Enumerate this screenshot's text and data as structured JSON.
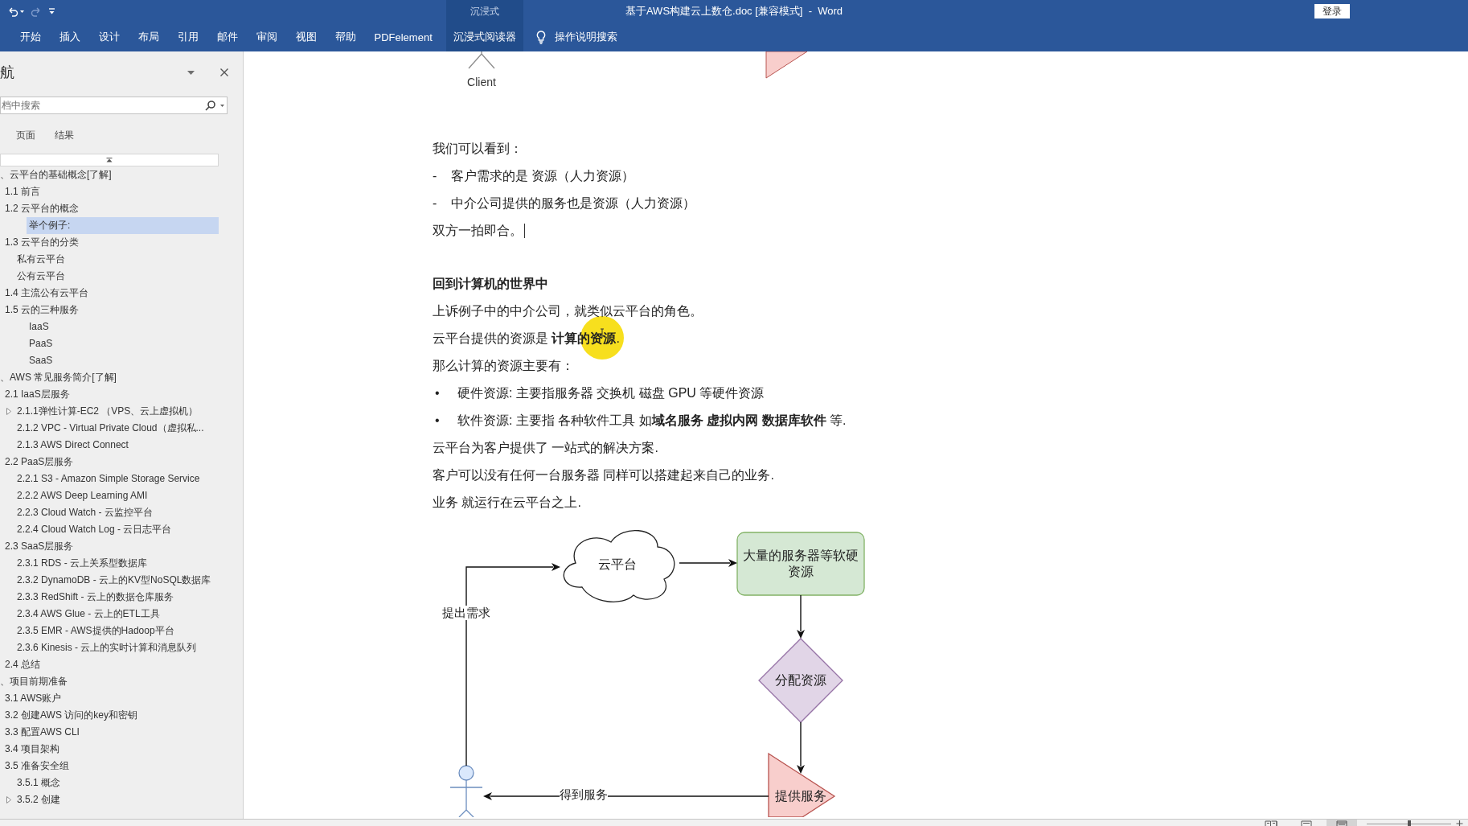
{
  "title_bar": {
    "quick_access": [
      {
        "kind": "undo",
        "disabled": false
      },
      {
        "kind": "redo",
        "disabled": true
      },
      {
        "kind": "customize",
        "disabled": false
      }
    ],
    "title": "基于AWS构建云上数仓.doc [兼容模式]  -  Word",
    "sign_in": "登录"
  },
  "ribbon": {
    "tabs": [
      {
        "label": "开始",
        "kind": "standard",
        "selected": false
      },
      {
        "label": "插入",
        "kind": "standard",
        "selected": false
      },
      {
        "label": "设计",
        "kind": "standard",
        "selected": false
      },
      {
        "label": "布局",
        "kind": "standard",
        "selected": false
      },
      {
        "label": "引用",
        "kind": "standard",
        "selected": false
      },
      {
        "label": "邮件",
        "kind": "standard",
        "selected": false
      },
      {
        "label": "审阅",
        "kind": "standard",
        "selected": false
      },
      {
        "label": "视图",
        "kind": "standard",
        "selected": false
      },
      {
        "label": "帮助",
        "kind": "standard",
        "selected": false
      },
      {
        "label": "PDFelement",
        "kind": "standard",
        "selected": false
      },
      {
        "label": "沉浸式阅读器",
        "kind": "contextual",
        "group": "沉浸式",
        "selected": false
      }
    ],
    "tell_me": "操作说明搜索"
  },
  "navigation_pane": {
    "title": "航",
    "search": {
      "placeholder": "档中搜索"
    },
    "tabs": [
      {
        "label": "页面",
        "selected": false
      },
      {
        "label": "结果",
        "selected": false
      }
    ],
    "tree": [
      {
        "label": "、云平台的基础概念[了解]",
        "kind": "normal",
        "selected": false,
        "collapsed": false,
        "children": [
          {
            "label": "1.1 前言",
            "kind": "normal",
            "selected": false,
            "collapsed": false
          },
          {
            "label": "1.2 云平台的概念",
            "kind": "normal",
            "selected": false,
            "collapsed": false,
            "children": [
              {
                "label": "举个例子:",
                "kind": "deep",
                "selected": true,
                "collapsed": false
              }
            ]
          },
          {
            "label": "1.3 云平台的分类",
            "kind": "normal",
            "selected": false,
            "collapsed": false,
            "children": [
              {
                "label": "私有云平台",
                "kind": "normal",
                "selected": false,
                "collapsed": false
              },
              {
                "label": "公有云平台",
                "kind": "normal",
                "selected": false,
                "collapsed": false
              }
            ]
          },
          {
            "label": "1.4 主流公有云平台",
            "kind": "normal",
            "selected": false,
            "collapsed": false
          },
          {
            "label": "1.5 云的三种服务",
            "kind": "normal",
            "selected": false,
            "collapsed": false,
            "children": [
              {
                "label": "IaaS",
                "kind": "deep",
                "selected": false,
                "collapsed": false
              },
              {
                "label": "PaaS",
                "kind": "deep",
                "selected": false,
                "collapsed": false
              },
              {
                "label": "SaaS",
                "kind": "deep",
                "selected": false,
                "collapsed": false
              }
            ]
          }
        ]
      },
      {
        "label": "、AWS 常见服务简介[了解]",
        "kind": "normal",
        "selected": false,
        "collapsed": false,
        "children": [
          {
            "label": "2.1 IaaS层服务",
            "kind": "normal",
            "selected": false,
            "collapsed": false,
            "children": [
              {
                "label": "2.1.1弹性计算-EC2 （VPS、云上虚拟机）",
                "kind": "normal",
                "selected": false,
                "collapsed": true
              },
              {
                "label": "2.1.2 VPC - Virtual Private Cloud（虚拟私...",
                "kind": "normal",
                "selected": false,
                "collapsed": false
              },
              {
                "label": "2.1.3 AWS Direct Connect",
                "kind": "normal",
                "selected": false,
                "collapsed": false
              }
            ]
          },
          {
            "label": "2.2 PaaS层服务",
            "kind": "normal",
            "selected": false,
            "collapsed": false,
            "children": [
              {
                "label": "2.2.1 S3 - Amazon Simple Storage Service",
                "kind": "normal",
                "selected": false,
                "collapsed": false
              },
              {
                "label": "2.2.2 AWS Deep Learning AMI",
                "kind": "normal",
                "selected": false,
                "collapsed": false
              },
              {
                "label": "2.2.3 Cloud Watch - 云监控平台",
                "kind": "normal",
                "selected": false,
                "collapsed": false
              },
              {
                "label": "2.2.4 Cloud Watch Log - 云日志平台",
                "kind": "normal",
                "selected": false,
                "collapsed": false
              }
            ]
          },
          {
            "label": "2.3 SaaS层服务",
            "kind": "normal",
            "selected": false,
            "collapsed": false,
            "children": [
              {
                "label": "2.3.1 RDS - 云上关系型数据库",
                "kind": "normal",
                "selected": false,
                "collapsed": false
              },
              {
                "label": "2.3.2 DynamoDB - 云上的KV型NoSQL数据库",
                "kind": "normal",
                "selected": false,
                "collapsed": false
              },
              {
                "label": "2.3.3 RedShift - 云上的数据仓库服务",
                "kind": "normal",
                "selected": false,
                "collapsed": false
              },
              {
                "label": "2.3.4 AWS Glue - 云上的ETL工具",
                "kind": "normal",
                "selected": false,
                "collapsed": false
              },
              {
                "label": "2.3.5 EMR - AWS提供的Hadoop平台",
                "kind": "normal",
                "selected": false,
                "collapsed": false
              },
              {
                "label": "2.3.6 Kinesis - 云上的实时计算和消息队列",
                "kind": "normal",
                "selected": false,
                "collapsed": false
              }
            ]
          },
          {
            "label": "2.4 总结",
            "kind": "normal",
            "selected": false,
            "collapsed": false
          }
        ]
      },
      {
        "label": "、项目前期准备",
        "kind": "normal",
        "selected": false,
        "collapsed": false,
        "children": [
          {
            "label": "3.1 AWS账户",
            "kind": "normal",
            "selected": false,
            "collapsed": false
          },
          {
            "label": "3.2 创建AWS 访问的key和密钥",
            "kind": "normal",
            "selected": false,
            "collapsed": false
          },
          {
            "label": "3.3 配置AWS CLI",
            "kind": "normal",
            "selected": false,
            "collapsed": false
          },
          {
            "label": "3.4 项目架构",
            "kind": "normal",
            "selected": false,
            "collapsed": false
          },
          {
            "label": "3.5 准备安全组",
            "kind": "normal",
            "selected": false,
            "collapsed": false,
            "children": [
              {
                "label": "3.5.1 概念",
                "kind": "normal",
                "selected": false,
                "collapsed": false
              },
              {
                "label": "3.5.2 创建",
                "kind": "normal",
                "selected": false,
                "collapsed": true
              }
            ]
          }
        ]
      }
    ]
  },
  "document": {
    "previous_figure": {
      "label": "Client"
    },
    "paragraphs": [
      {
        "kind": "text",
        "text": "我们可以看到：",
        "cursor": false,
        "pointer": false
      },
      {
        "kind": "dash",
        "marker": "-",
        "text": "客户需求的是 资源（人力资源）",
        "cursor": false,
        "pointer": false
      },
      {
        "kind": "dash",
        "marker": "-",
        "text": "中介公司提供的服务也是资源（人力资源）",
        "cursor": false,
        "pointer": false
      },
      {
        "kind": "text",
        "text": "双方一拍即合。",
        "cursor": true,
        "pointer": false
      },
      {
        "kind": "heading",
        "text": "回到计算机的世界中",
        "cursor": false,
        "pointer": false
      },
      {
        "kind": "text",
        "text": "上诉例子中的中介公司，就类似云平台的角色。",
        "cursor": false,
        "pointer": false
      },
      {
        "kind": "text",
        "text": "云平台提供的资源是 **计算的资源**.",
        "cursor": false,
        "pointer": true
      },
      {
        "kind": "text",
        "text": "那么计算的资源主要有：",
        "cursor": false,
        "pointer": false
      },
      {
        "kind": "bullet",
        "marker": "•",
        "text": "硬件资源: 主要指服务器 交换机 磁盘 GPU 等硬件资源",
        "cursor": false,
        "pointer": false
      },
      {
        "kind": "bullet",
        "marker": "•",
        "text": "软件资源: 主要指 各种软件工具 如**域名服务 虚拟内网 数据库软件** 等.",
        "cursor": false,
        "pointer": false
      },
      {
        "kind": "text",
        "text": "云平台为客户提供了 一站式的解决方案.",
        "cursor": false,
        "pointer": false
      },
      {
        "kind": "text",
        "text": "客户可以没有任何一台服务器 同样可以搭建起来自己的业务.",
        "cursor": false,
        "pointer": false
      },
      {
        "kind": "text",
        "text": "业务 就运行在云平台之上.",
        "cursor": false,
        "pointer": false
      }
    ],
    "diagram": {
      "nodes": [
        {
          "kind": "cloud",
          "label": "云平台"
        },
        {
          "kind": "process",
          "label": "大量的服务器等软硬资源"
        },
        {
          "kind": "decision",
          "label": "分配资源"
        },
        {
          "kind": "output",
          "label": "提供服务"
        },
        {
          "kind": "actor"
        }
      ],
      "edge_labels": [
        "提出需求",
        "得到服务"
      ]
    }
  },
  "status_bar": {
    "views": [
      {
        "kind": "read",
        "selected": false
      },
      {
        "kind": "print",
        "selected": false
      },
      {
        "kind": "web",
        "selected": true
      }
    ],
    "zoom": {
      "level": 0.5
    }
  }
}
